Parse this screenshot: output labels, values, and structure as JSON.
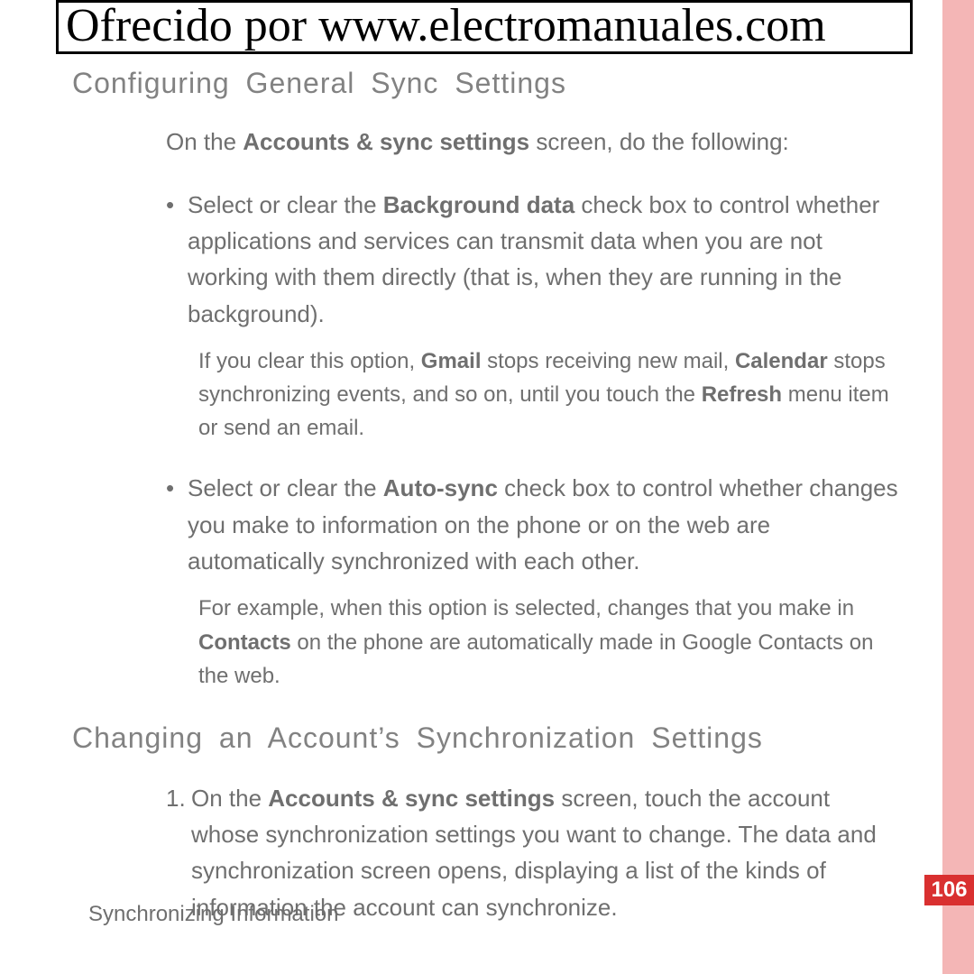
{
  "header": {
    "banner": "Ofrecido por www.electromanuales.com"
  },
  "section1": {
    "heading": "Configuring General Sync Settings",
    "intro_pre": "On the ",
    "intro_bold": "Accounts & sync settings",
    "intro_post": " screen, do the following:",
    "bullet1_pre": "Select or clear the ",
    "bullet1_bold": "Background data",
    "bullet1_post": " check box to control whether applications and services can transmit data when you are not working with them directly (that is, when they are running in the background).",
    "note1_pre": "If you clear this option, ",
    "note1_bold1": "Gmail",
    "note1_mid1": " stops receiving new mail, ",
    "note1_bold2": "Calendar",
    "note1_mid2": " stops synchronizing events, and so on, until you touch the ",
    "note1_bold3": "Refresh",
    "note1_post": " menu item or send an email.",
    "bullet2_pre": "Select or clear the ",
    "bullet2_bold": "Auto-sync",
    "bullet2_post": " check box to control whether changes you make to information on the phone or on the web are automatically synchronized with each other.",
    "note2_pre": "For example, when this option is selected, changes that you make in ",
    "note2_bold": "Contacts",
    "note2_post": " on the phone are automatically made in Google Contacts on the web."
  },
  "section2": {
    "heading": "Changing an Account’s Synchronization Settings",
    "item1_num": "1.",
    "item1_pre": "On the ",
    "item1_bold": "Accounts & sync settings",
    "item1_post": " screen, touch the account whose synchronization settings you want to change. The data and synchronization screen opens, displaying a list of the kinds of information the account can synchronize."
  },
  "footer": {
    "text": "Synchronizing Information"
  },
  "page": {
    "number": "106"
  }
}
